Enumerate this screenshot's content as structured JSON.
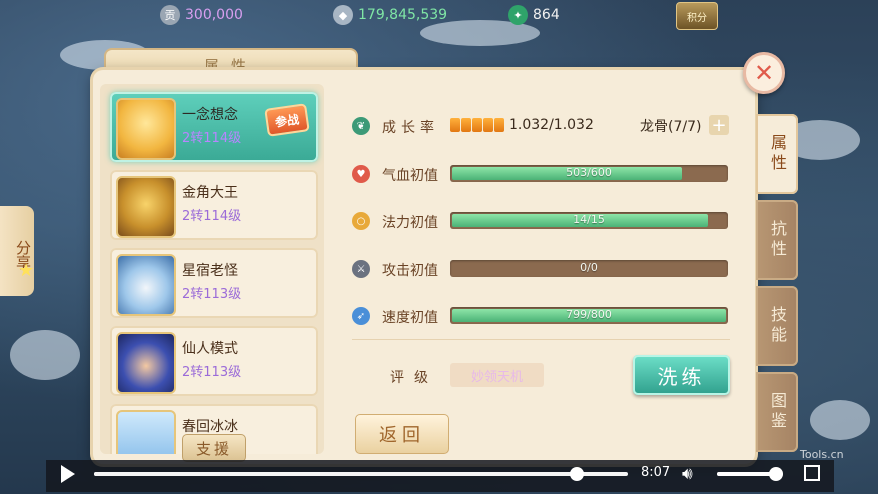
{
  "currency": {
    "coins": "300,000",
    "silver": "179,845,539",
    "jade": "864"
  },
  "top_button_label": "积分",
  "panel": {
    "tab_title": "属性",
    "close_symbol": "✕"
  },
  "roster": [
    {
      "name": "一念想念",
      "level": "2转114级",
      "selected": true,
      "badge": "参战"
    },
    {
      "name": "金角大王",
      "level": "2转114级",
      "selected": false
    },
    {
      "name": "星宿老怪",
      "level": "2转113级",
      "selected": false
    },
    {
      "name": "仙人模式",
      "level": "2转113级",
      "selected": false
    },
    {
      "name": "春回冰冰",
      "level": "",
      "selected": false
    }
  ],
  "support_button": "支援",
  "growth": {
    "label": "成长率",
    "value": "1.032/1.032",
    "pips": 5,
    "bone_label": "龙骨(7/7)",
    "bone_plus": "+"
  },
  "stats": [
    {
      "label": "气血初值",
      "value": "503/600",
      "fraction": 0.8383,
      "color": "#e05a4a"
    },
    {
      "label": "法力初值",
      "value": "14/15",
      "fraction": 0.9333,
      "color": "#e8a93a"
    },
    {
      "label": "攻击初值",
      "value": "0/0",
      "fraction": 0,
      "color": "#6b7280"
    },
    {
      "label": "速度初值",
      "value": "799/800",
      "fraction": 0.99875,
      "color": "#4a8fd8"
    }
  ],
  "rating": {
    "label": "评级",
    "value": "妙领天机"
  },
  "wash_button": "洗练",
  "back_button": "返回",
  "side_tabs": [
    {
      "label": "属性",
      "active": true
    },
    {
      "label": "抗性",
      "active": false
    },
    {
      "label": "技能",
      "active": false
    },
    {
      "label": "图鉴",
      "active": false
    }
  ],
  "share_label": "分享",
  "video": {
    "time": "8:07",
    "progress": 0.905,
    "volume": 0.9
  },
  "watermark": "Tools.cn"
}
